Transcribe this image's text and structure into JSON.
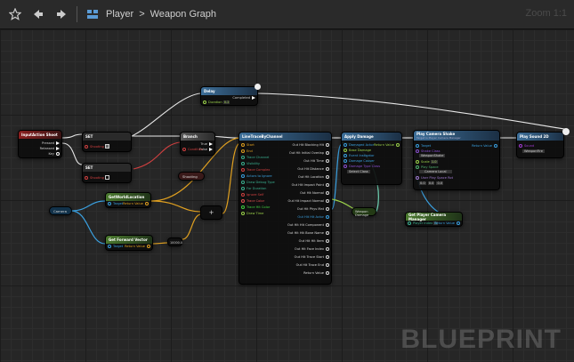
{
  "toolbar": {
    "breadcrumb_root": "Player",
    "breadcrumb_sep": ">",
    "breadcrumb_leaf": "Weapon Graph",
    "zoom_label": "Zoom 1:1"
  },
  "watermark": "BLUEPRINT",
  "nodes": {
    "input_action": {
      "title": "InputAction Shoot",
      "pins": [
        "Pressed",
        "Released",
        "Key"
      ]
    },
    "set_shooting_1": {
      "title": "SET",
      "pins": [
        "Shooting"
      ]
    },
    "set_shooting_2": {
      "title": "SET",
      "pins": [
        "Shooting"
      ]
    },
    "delay": {
      "title": "Delay",
      "pins": [
        "Completed",
        "Duration"
      ],
      "duration": "0.2"
    },
    "branch": {
      "title": "Branch",
      "pins": [
        "True",
        "False",
        "Condition"
      ]
    },
    "shooting_var": {
      "title": "Shooting"
    },
    "line_trace": {
      "title": "LineTraceByChannel",
      "inputs": [
        "Start",
        "End",
        "Trace Channel",
        "Visibility",
        "Trace Complex",
        "Actors to Ignore",
        "Draw Debug Type",
        "For Duration",
        "Ignore Self",
        "Trace Color",
        "Trace Hit Color",
        "Draw Time"
      ],
      "outputs": [
        "Out Hit Blocking Hit",
        "Out Hit Initial Overlap",
        "Out Hit Time",
        "Out Hit Distance",
        "Out Hit Location",
        "Out Hit Impact Point",
        "Out Hit Normal",
        "Out Hit Impact Normal",
        "Out Hit Phys Mat",
        "Out Hit Hit Actor",
        "Out Hit Hit Component",
        "Out Hit Hit Bone Name",
        "Out Hit Hit Item",
        "Out Hit Face Index",
        "Out Hit Trace Start",
        "Out Hit Trace End",
        "Return Value"
      ],
      "draw_time": "5.0"
    },
    "apply_damage": {
      "title": "Apply Damage",
      "pins": [
        "Damaged Actor",
        "Base Damage",
        "Event Instigator",
        "Damage Causer",
        "Damage Type Class",
        "Return Value"
      ],
      "damage_class": "Select Class"
    },
    "play_camera_shake": {
      "title": "Play Camera Shake",
      "subtitle": "Target is Player Camera Manager",
      "pins": [
        "Target",
        "Shake Class",
        "Scale",
        "Play Space",
        "User Play Space Rot",
        "Return Value"
      ],
      "shake_class": "WeaponShake",
      "scale": "1.0",
      "play_space": "Camera Local",
      "rot": [
        "0.0",
        "0.0",
        "0.0"
      ]
    },
    "play_sound": {
      "title": "Play Sound 2D",
      "pins": [
        "Sound"
      ],
      "sound": "WeaponFire"
    },
    "get_world_location": {
      "title": "GetWorldLocation",
      "subtitle": "Target is Scene Component",
      "pins": [
        "Target",
        "Return Value"
      ]
    },
    "get_forward_vector": {
      "title": "Get Forward Vector",
      "subtitle": "Target is Scene Component",
      "pins": [
        "Target",
        "Return Value"
      ]
    },
    "camera_var": {
      "title": "Camera"
    },
    "add_node": {
      "title": "+"
    },
    "multiply_node": {
      "title": "10000.0"
    },
    "weapon_damage": {
      "title": "Weapon Damage"
    },
    "get_camera_manager": {
      "title": "Get Player Camera Manager",
      "pins": [
        "Player Index",
        "Return Value"
      ],
      "player_index": "0"
    }
  }
}
